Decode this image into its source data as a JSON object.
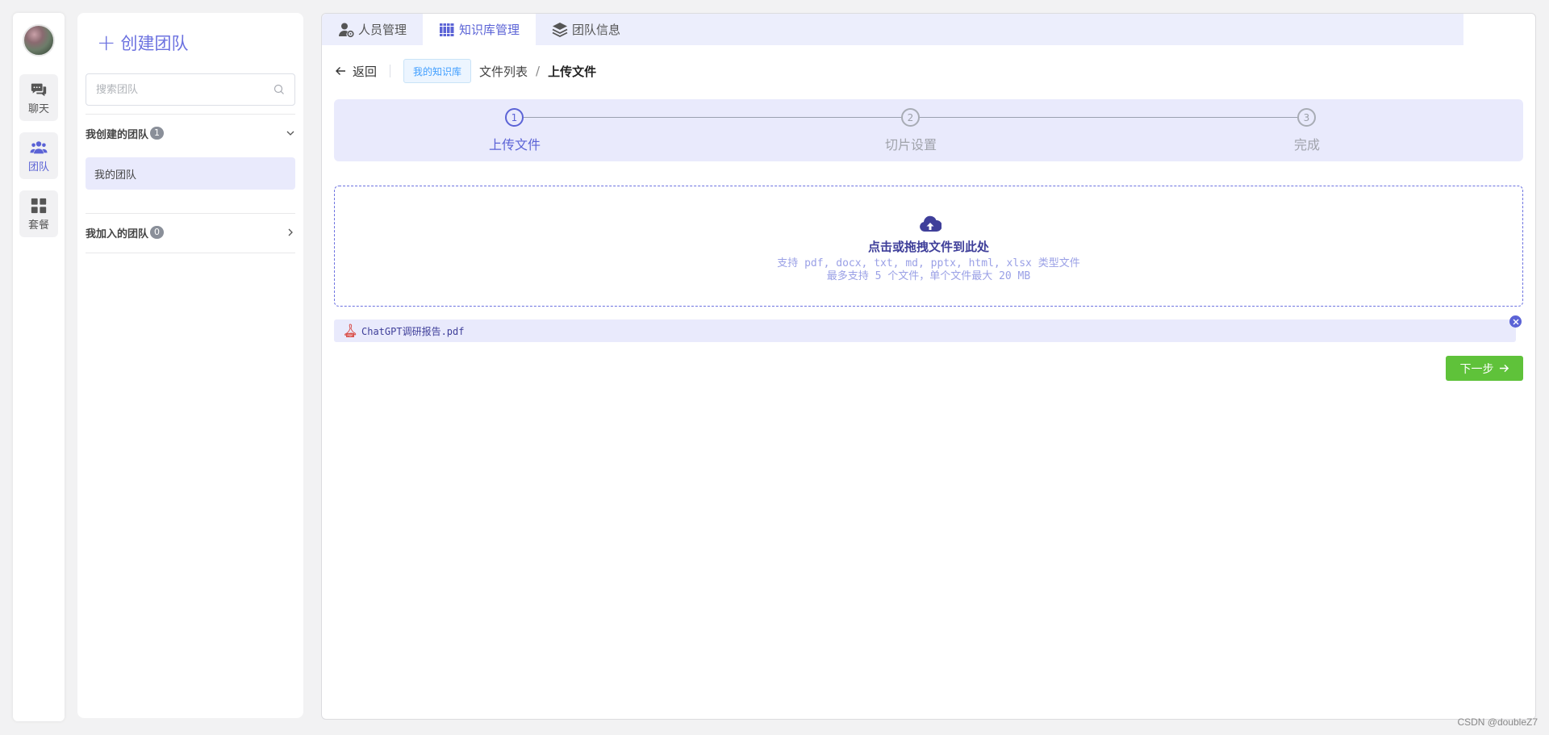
{
  "rail": {
    "items": [
      {
        "label": "聊天",
        "icon": "chat-icon"
      },
      {
        "label": "团队",
        "icon": "team-icon"
      },
      {
        "label": "套餐",
        "icon": "grid-icon"
      }
    ],
    "active_index": 1
  },
  "team_panel": {
    "create_label": "创建团队",
    "search_placeholder": "搜索团队",
    "created_group": {
      "title": "我创建的团队",
      "count": "1",
      "teams": [
        "我的团队"
      ]
    },
    "joined_group": {
      "title": "我加入的团队",
      "count": "0"
    }
  },
  "tabs": [
    {
      "label": "人员管理",
      "icon": "user-gear-icon"
    },
    {
      "label": "知识库管理",
      "icon": "books-icon"
    },
    {
      "label": "团队信息",
      "icon": "layers-icon"
    }
  ],
  "active_tab": 1,
  "breadcrumb": {
    "back_label": "返回",
    "kb_tag": "我的知识库",
    "items": [
      "文件列表",
      "上传文件"
    ],
    "separator": "/"
  },
  "steps": [
    {
      "num": "1",
      "label": "上传文件"
    },
    {
      "num": "2",
      "label": "切片设置"
    },
    {
      "num": "3",
      "label": "完成"
    }
  ],
  "active_step": 0,
  "upload": {
    "title": "点击或拖拽文件到此处",
    "tip_types": "支持 pdf, docx, txt, md, pptx, html, xlsx 类型文件",
    "tip_limit": "最多支持 5 个文件，单个文件最大 20 MB"
  },
  "files": [
    {
      "name": "ChatGPT调研报告.pdf",
      "icon": "pdf-icon"
    }
  ],
  "next_label": "下一步",
  "watermark": "CSDN @doubleZ7",
  "colors": {
    "accent": "#5b63d6",
    "accent_light": "#e9eafc",
    "success": "#5fc23a"
  }
}
